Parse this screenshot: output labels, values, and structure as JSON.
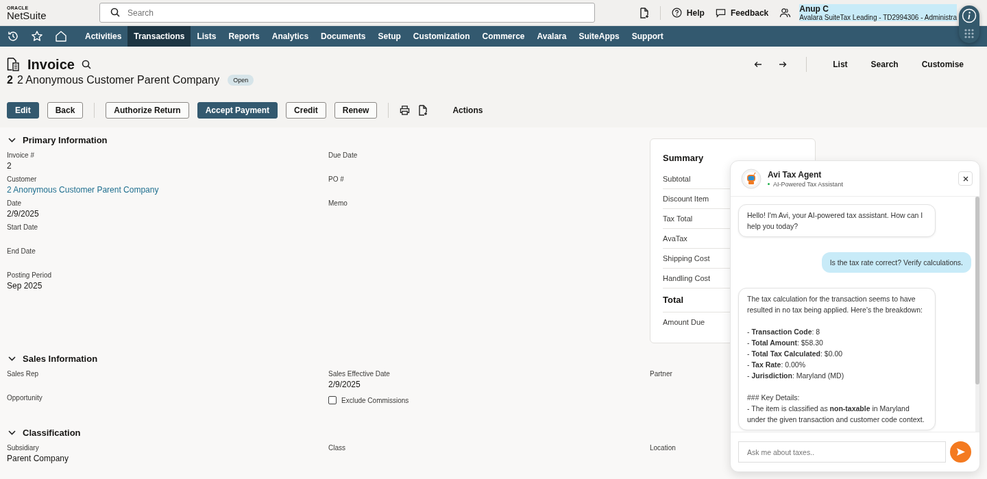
{
  "header": {
    "logo_top": "ORACLE",
    "logo_main": "NetSuite",
    "search": {
      "placeholder": "Search"
    },
    "links": [
      {
        "kind": "help",
        "label": "Help"
      },
      {
        "kind": "feedback",
        "label": "Feedback"
      }
    ],
    "user": {
      "name": "Anup C",
      "role": "Avalara SuiteTax Leading - TD2994306 - Administra"
    }
  },
  "nav": [
    {
      "label": "Activities",
      "selected": false
    },
    {
      "label": "Transactions",
      "selected": true
    },
    {
      "label": "Lists",
      "selected": false
    },
    {
      "label": "Reports",
      "selected": false
    },
    {
      "label": "Analytics",
      "selected": false
    },
    {
      "label": "Documents",
      "selected": false
    },
    {
      "label": "Setup",
      "selected": false
    },
    {
      "label": "Customization",
      "selected": false
    },
    {
      "label": "Commerce",
      "selected": false
    },
    {
      "label": "Avalara",
      "selected": false
    },
    {
      "label": "SuiteApps",
      "selected": false
    },
    {
      "label": "Support",
      "selected": false
    }
  ],
  "record": {
    "type": "Invoice",
    "number": "2",
    "name": "2 Anonymous Customer Parent Company",
    "status": "Open",
    "links": [
      "List",
      "Search",
      "Customise"
    ]
  },
  "buttons": [
    {
      "label": "Edit",
      "kind": "primary"
    },
    {
      "label": "Back",
      "kind": "secondary"
    },
    {
      "label": "Authorize Return",
      "kind": "secondary"
    },
    {
      "label": "Accept Payment",
      "kind": "primary"
    },
    {
      "label": "Credit",
      "kind": "secondary"
    },
    {
      "label": "Renew",
      "kind": "secondary"
    }
  ],
  "actions_label": "Actions",
  "sections": [
    {
      "title": "Primary Information",
      "expanded": true,
      "columns": [
        [
          {
            "kind": "text",
            "label": "Invoice #",
            "value": "2"
          },
          {
            "kind": "link",
            "label": "Customer",
            "value": "2 Anonymous Customer Parent Company"
          },
          {
            "kind": "text",
            "label": "Date",
            "value": "2/9/2025"
          },
          {
            "kind": "text",
            "label": "Start Date"
          },
          {
            "kind": "text",
            "label": "End Date"
          },
          {
            "kind": "text",
            "label": "Posting Period",
            "value": "Sep 2025"
          }
        ],
        [
          {
            "kind": "text",
            "label": "Due Date"
          },
          {
            "kind": "text",
            "label": "PO #"
          },
          {
            "kind": "text",
            "label": "Memo"
          }
        ]
      ],
      "summary": {
        "title": "Summary",
        "rows": [
          {
            "label": "Subtotal",
            "kind": "normal"
          },
          {
            "label": "Discount Item",
            "kind": "normal"
          },
          {
            "label": "Tax Total",
            "kind": "normal"
          },
          {
            "label": "AvaTax",
            "kind": "normal"
          },
          {
            "label": "Shipping Cost",
            "kind": "normal"
          },
          {
            "label": "Handling Cost",
            "kind": "normal"
          },
          {
            "label": "Total",
            "kind": "total"
          },
          {
            "label": "Amount Due",
            "kind": "normal"
          }
        ]
      }
    },
    {
      "title": "Sales Information",
      "expanded": true,
      "columns": [
        [
          {
            "kind": "text",
            "label": "Sales Rep"
          },
          {
            "kind": "text",
            "label": "Opportunity"
          }
        ],
        [
          {
            "kind": "text",
            "label": "Sales Effective Date",
            "value": "2/9/2025"
          },
          {
            "kind": "checkbox",
            "label": "Exclude Commissions",
            "checked": false
          }
        ],
        [
          {
            "kind": "text",
            "label": "Partner"
          }
        ]
      ]
    },
    {
      "title": "Classification",
      "expanded": true,
      "columns": [
        [
          {
            "kind": "text",
            "label": "Subsidiary",
            "value": "Parent Company"
          }
        ],
        [
          {
            "kind": "text",
            "label": "Class"
          }
        ],
        [
          {
            "kind": "text",
            "label": "Location"
          }
        ]
      ]
    }
  ],
  "chat": {
    "title": "Avi Tax Agent",
    "subtitle": "AI-Powered Tax Assistant",
    "messages": [
      {
        "kind": "agent",
        "paragraphs": [
          [
            "Hello! I'm Avi, your AI-powered tax assistant. How can I help you today?"
          ]
        ]
      },
      {
        "kind": "user",
        "paragraphs": [
          [
            "Is the tax rate correct? Verify calculations."
          ]
        ]
      },
      {
        "kind": "agent",
        "paragraphs": [
          [
            "The tax calculation for the transaction seems to have resulted in no tax being applied. Here's the breakdown:"
          ],
          [
            "- **Transaction Code**: 8",
            "- **Total Amount**: $58.30",
            "- **Total Tax Calculated**: $0.00",
            "- **Tax Rate**: 0.00%",
            "- **Jurisdiction**: Maryland (MD)"
          ],
          [
            "### Key Details:",
            "- The item is classified as **non-taxable** in Maryland under the given transaction and customer code context."
          ]
        ]
      }
    ],
    "input": {
      "placeholder": "Ask me about taxes.."
    }
  }
}
